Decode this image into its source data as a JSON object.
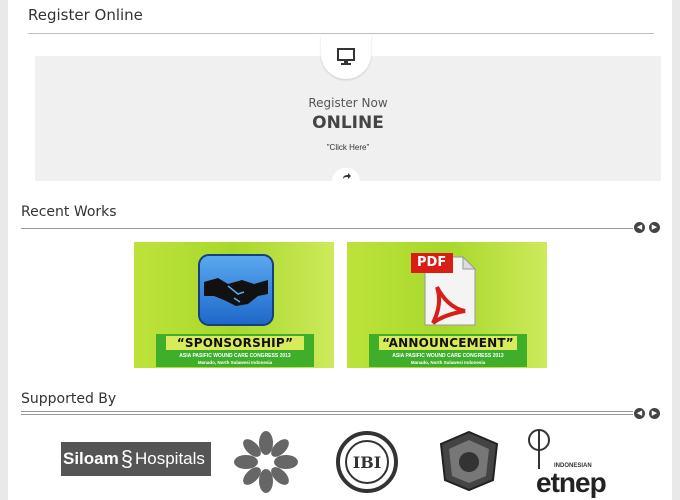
{
  "register": {
    "title": "Register Online",
    "line1": "Register Now",
    "line2": "ONLINE",
    "click": "\"Click Here\""
  },
  "recent_works": {
    "title": "Recent Works",
    "cards": [
      {
        "title": "“SPONSORSHIP”",
        "sub1": "ASIA PASIFIC WOUND CARE CONGRESS 2013",
        "sub2": "Manado, North Sulawesi Indonesia",
        "icon": "handshake-icon"
      },
      {
        "title": "“ANNOUNCEMENT”",
        "sub1": "ASIA PASIFIC WOUND CARE CONGRESS 2013",
        "sub2": "Manado, North Sulawesi Indonesia",
        "icon": "pdf-icon",
        "pdf_label": "PDF"
      }
    ]
  },
  "supported_by": {
    "title": "Supported By",
    "logos": [
      {
        "name": "siloam-hospitals-logo",
        "text1": "Siloam",
        "text2": "Hospitals"
      },
      {
        "name": "flower-logo"
      },
      {
        "name": "ibi-logo",
        "text": "IBI"
      },
      {
        "name": "government-seal-logo"
      },
      {
        "name": "etnep-logo",
        "text": "etnep",
        "small": "INDONESIAN"
      }
    ]
  },
  "colors": {
    "card_green": "#a8d82c",
    "banner_green": "#3fae2b",
    "arrow": "#444444"
  }
}
